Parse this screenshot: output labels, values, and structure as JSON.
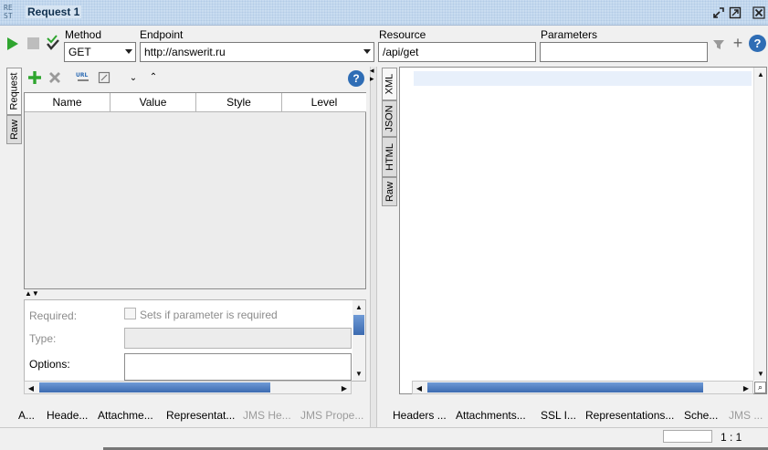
{
  "window": {
    "title": "Request 1",
    "logo": "RE ST"
  },
  "toolbar": {
    "method_label": "Method",
    "method_value": "GET",
    "endpoint_label": "Endpoint",
    "endpoint_value": "http://answerit.ru",
    "resource_label": "Resource",
    "resource_value": "/api/get",
    "parameters_label": "Parameters",
    "parameters_value": ""
  },
  "request_panel": {
    "side_tabs": [
      "Request",
      "Raw"
    ],
    "columns": [
      "Name",
      "Value",
      "Style",
      "Level"
    ],
    "detail": {
      "required_label": "Required:",
      "required_checkbox_text": "Sets if parameter is required",
      "type_label": "Type:",
      "options_label": "Options:"
    },
    "bottom_tabs": [
      {
        "label": "A...",
        "enabled": true
      },
      {
        "label": "Heade...",
        "enabled": true
      },
      {
        "label": "Attachme...",
        "enabled": true
      },
      {
        "label": "Representat...",
        "enabled": true
      },
      {
        "label": "JMS He...",
        "enabled": false
      },
      {
        "label": "JMS Prope...",
        "enabled": false
      }
    ]
  },
  "response_panel": {
    "side_tabs": [
      "XML",
      "JSON",
      "HTML",
      "Raw"
    ],
    "bottom_tabs": [
      {
        "label": "Headers ...",
        "enabled": true
      },
      {
        "label": "Attachments...",
        "enabled": true
      },
      {
        "label": "SSL I...",
        "enabled": true
      },
      {
        "label": "Representations...",
        "enabled": true
      },
      {
        "label": "Sche...",
        "enabled": true
      },
      {
        "label": "JMS ...",
        "enabled": false
      }
    ]
  },
  "status": {
    "position": "1 : 1"
  },
  "colors": {
    "accent": "#2f9e2f",
    "help": "#2f6db5",
    "titlebar": "#c9dcf0"
  }
}
